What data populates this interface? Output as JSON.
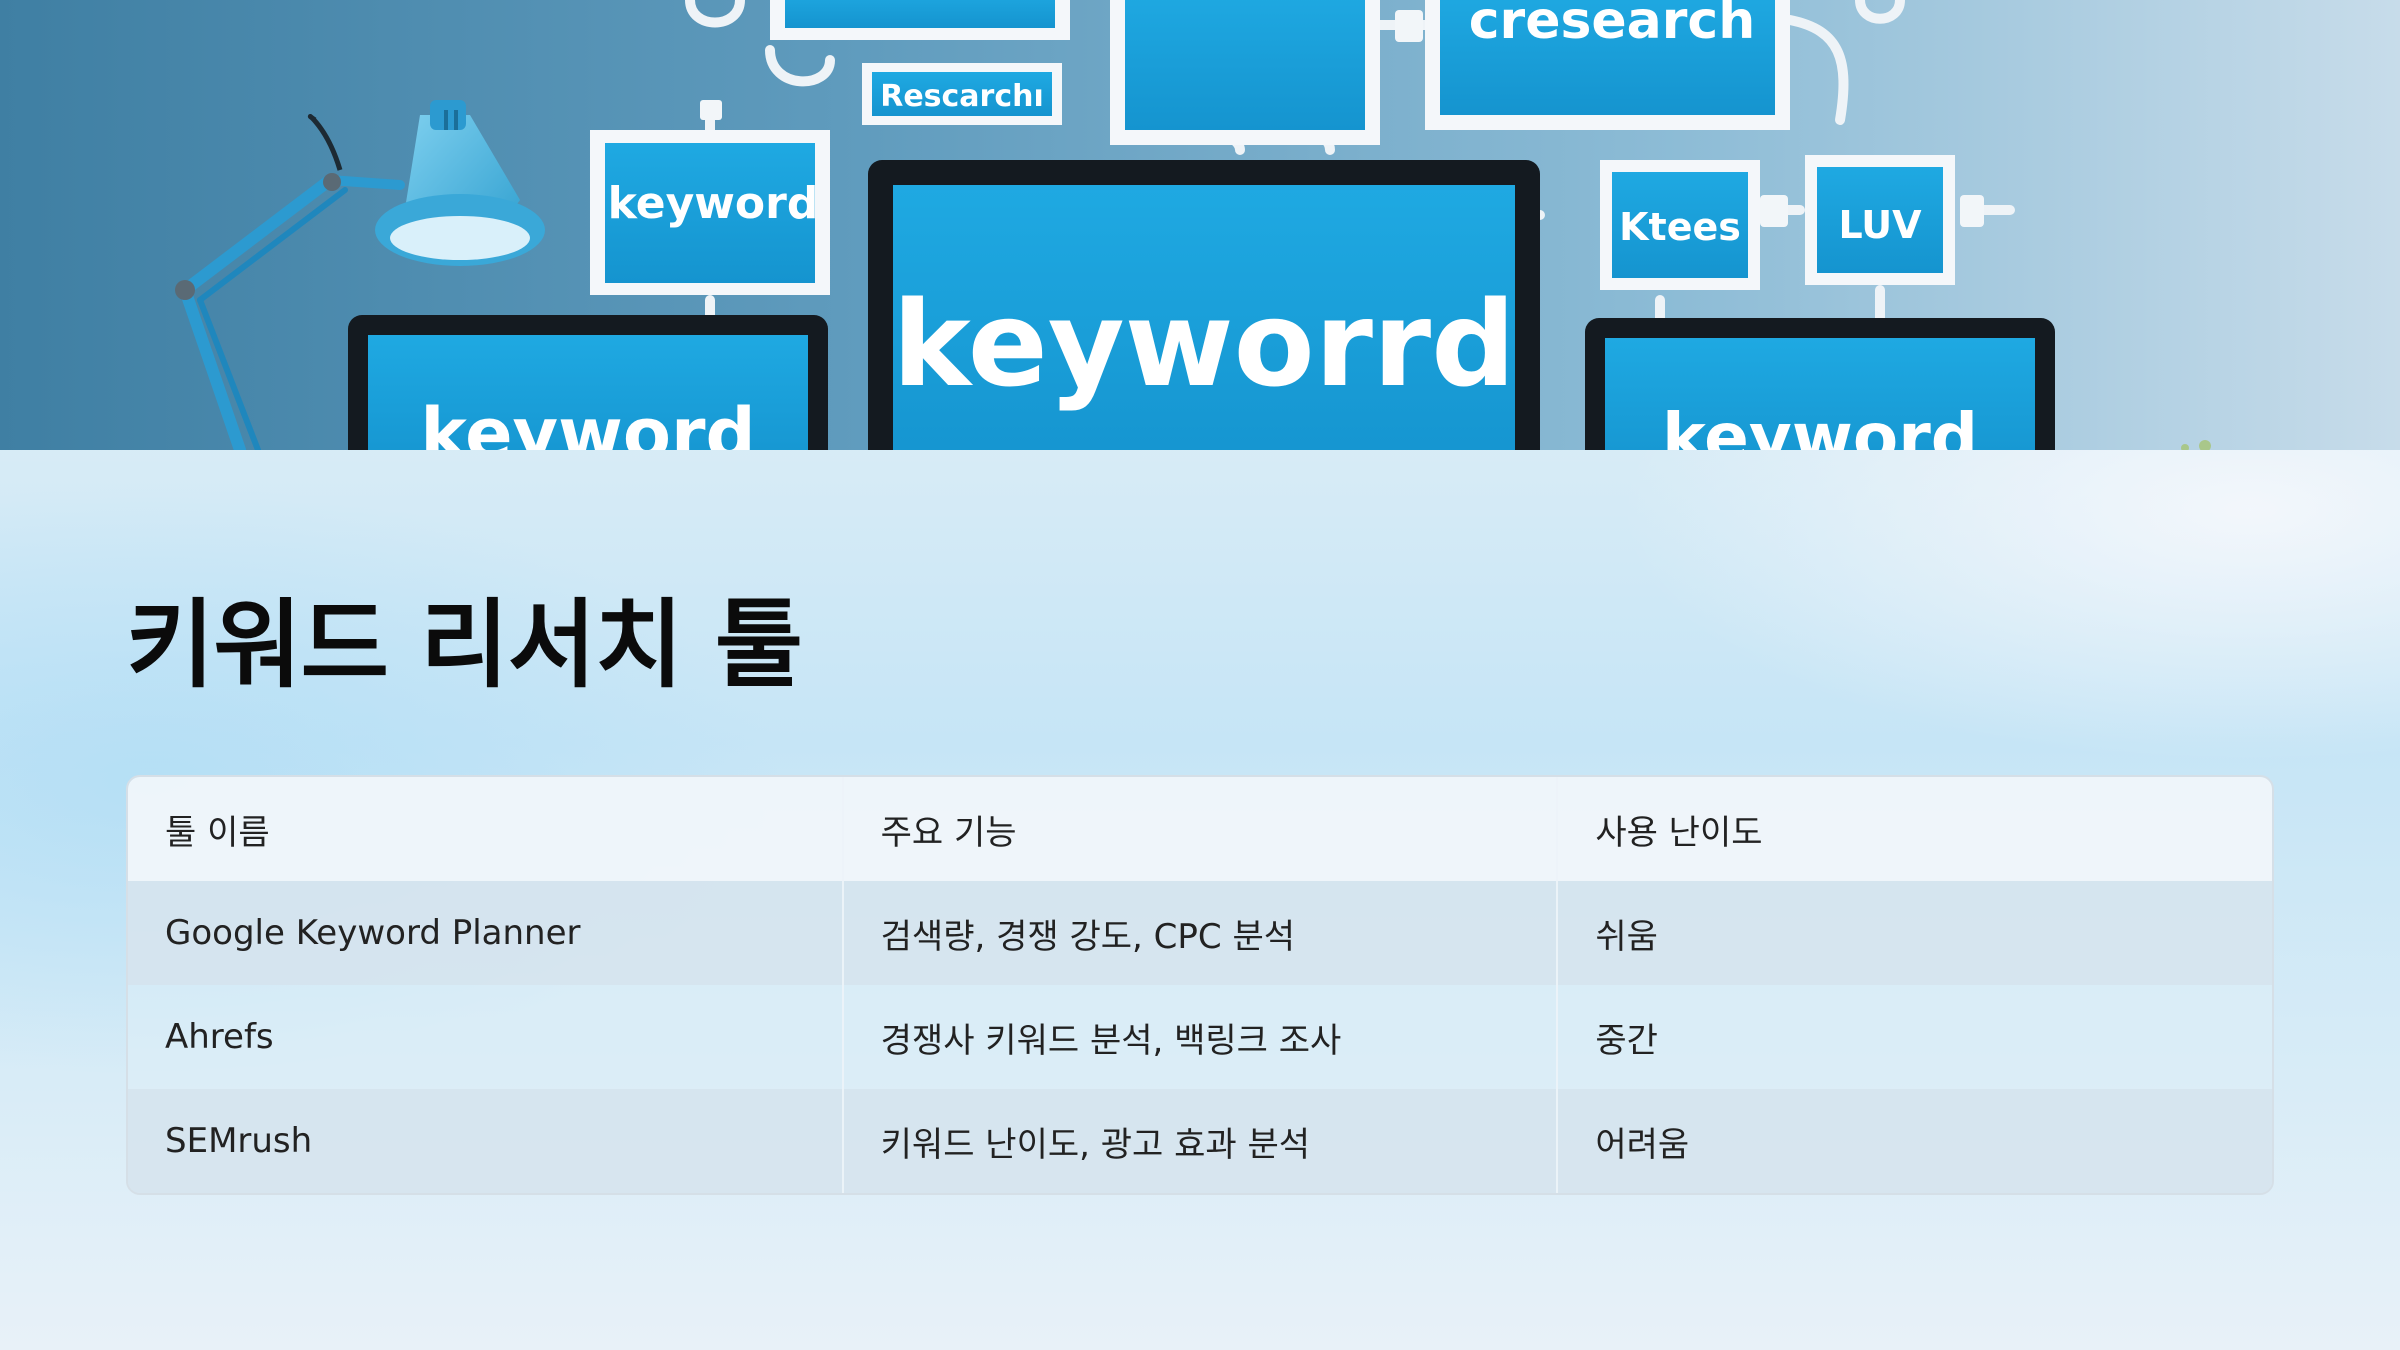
{
  "hero_image": {
    "alt_words": [
      "cresearch",
      "Rescarchı",
      "keyword",
      "Ktees",
      "LUV",
      "keyworrd",
      "keyword",
      "keyword"
    ]
  },
  "title": "키워드 리서치 툴",
  "table": {
    "headers": [
      "툴 이름",
      "주요 기능",
      "사용 난이도"
    ],
    "rows": [
      [
        "Google Keyword Planner",
        "검색량, 경쟁 강도, CPC 분석",
        "쉬움"
      ],
      [
        "Ahrefs",
        "경쟁사 키워드 분석, 백링크 조사",
        "중간"
      ],
      [
        "SEMrush",
        "키워드 난이도, 광고 효과 분석",
        "어려움"
      ]
    ]
  },
  "colors": {
    "title": "#0b0b0b",
    "hero_screen": "#1aa3dd",
    "hero_wall": "#7fb3cf"
  }
}
